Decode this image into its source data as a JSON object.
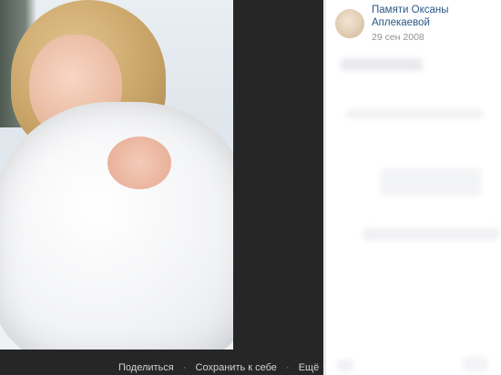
{
  "sidebar": {
    "author_name": "Памяти Оксаны Аплекаевой",
    "date": "29 сен 2008"
  },
  "actions": {
    "share": "Поделиться",
    "save": "Сохранить к себе",
    "more": "Ещё"
  }
}
